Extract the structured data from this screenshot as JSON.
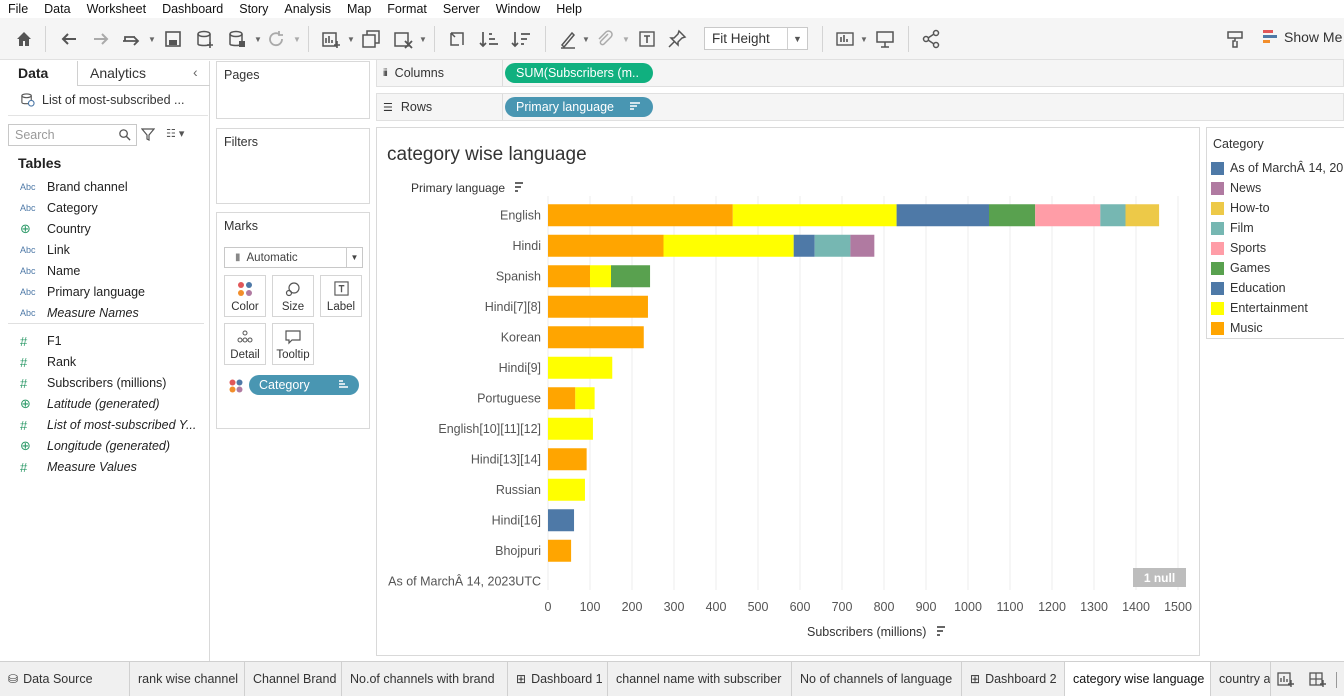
{
  "menu": [
    "File",
    "Data",
    "Worksheet",
    "Dashboard",
    "Story",
    "Analysis",
    "Map",
    "Format",
    "Server",
    "Window",
    "Help"
  ],
  "toolbar": {
    "fit_value": "Fit Height",
    "show_me": "Show Me"
  },
  "left_pane": {
    "tab_data": "Data",
    "tab_analytics": "Analytics",
    "datasource": "List of most-subscribed ...",
    "search_placeholder": "Search",
    "tables_heading": "Tables",
    "fields": [
      {
        "type": "Abc",
        "name": "Brand channel",
        "italic": false
      },
      {
        "type": "Abc",
        "name": "Category",
        "italic": false
      },
      {
        "type": "globe",
        "name": "Country",
        "italic": false
      },
      {
        "type": "Abc",
        "name": "Link",
        "italic": false
      },
      {
        "type": "Abc",
        "name": "Name",
        "italic": false
      },
      {
        "type": "Abc",
        "name": "Primary language",
        "italic": false
      },
      {
        "type": "Abc",
        "name": "Measure Names",
        "italic": true
      },
      {
        "type": "#",
        "name": "F1",
        "italic": false
      },
      {
        "type": "#",
        "name": "Rank",
        "italic": false
      },
      {
        "type": "#",
        "name": "Subscribers (millions)",
        "italic": false
      },
      {
        "type": "globe",
        "name": "Latitude (generated)",
        "italic": true
      },
      {
        "type": "#",
        "name": "List of most-subscribed Y...",
        "italic": true
      },
      {
        "type": "globe",
        "name": "Longitude (generated)",
        "italic": true
      },
      {
        "type": "#",
        "name": "Measure Values",
        "italic": true
      }
    ]
  },
  "cards": {
    "pages": "Pages",
    "filters": "Filters",
    "marks": "Marks",
    "marks_type": "Automatic",
    "buttons": {
      "color": "Color",
      "size": "Size",
      "label": "Label",
      "detail": "Detail",
      "tooltip": "Tooltip"
    },
    "category_pill": "Category"
  },
  "shelves": {
    "columns_label": "Columns",
    "columns_pill": "SUM(Subscribers (m..",
    "rows_label": "Rows",
    "rows_pill": "Primary language"
  },
  "view": {
    "title": "category wise language",
    "row_header": "Primary language",
    "null_badge": "1 null"
  },
  "legend": {
    "title": "Category",
    "items": [
      {
        "label": "As of MarchÂ 14, 20..",
        "color": "#4e79a7"
      },
      {
        "label": "News",
        "color": "#b07aa1"
      },
      {
        "label": "How-to",
        "color": "#edc948"
      },
      {
        "label": "Film",
        "color": "#76b7b2"
      },
      {
        "label": "Sports",
        "color": "#ff9da7"
      },
      {
        "label": "Games",
        "color": "#59a14f"
      },
      {
        "label": "Education",
        "color": "#4e79a7"
      },
      {
        "label": "Entertainment",
        "color": "#ffff00"
      },
      {
        "label": "Music",
        "color": "#ffa500"
      }
    ]
  },
  "chart_data": {
    "type": "bar",
    "orientation": "horizontal",
    "stacked": true,
    "xlabel": "Subscribers (millions)",
    "ylabel": "Primary language",
    "xlim": [
      0,
      1500
    ],
    "xticks": [
      0,
      100,
      200,
      300,
      400,
      500,
      600,
      700,
      800,
      900,
      1000,
      1100,
      1200,
      1300,
      1400,
      1500
    ],
    "colors": {
      "Music": "#ffa500",
      "Entertainment": "#ffff00",
      "Education": "#4e79a7",
      "Games": "#59a14f",
      "Sports": "#ff9da7",
      "Film": "#76b7b2",
      "How-to": "#edc948",
      "News": "#b07aa1"
    },
    "categories": [
      "English",
      "Hindi",
      "Spanish",
      "Hindi[7][8]",
      "Korean",
      "Hindi[9]",
      "Portuguese",
      "English[10][11][12]",
      "Hindi[13][14]",
      "Russian",
      "Hindi[16]",
      "Bhojpuri",
      "As of MarchÂ 14, 2023UTC"
    ],
    "bars": [
      [
        {
          "c": "Music",
          "v": 440
        },
        {
          "c": "Entertainment",
          "v": 390
        },
        {
          "c": "Education",
          "v": 220
        },
        {
          "c": "Games",
          "v": 110
        },
        {
          "c": "Sports",
          "v": 155
        },
        {
          "c": "Film",
          "v": 60
        },
        {
          "c": "How-to",
          "v": 80
        }
      ],
      [
        {
          "c": "Music",
          "v": 275
        },
        {
          "c": "Entertainment",
          "v": 310
        },
        {
          "c": "Education",
          "v": 50
        },
        {
          "c": "Film",
          "v": 85
        },
        {
          "c": "News",
          "v": 57
        }
      ],
      [
        {
          "c": "Music",
          "v": 100
        },
        {
          "c": "Entertainment",
          "v": 50
        },
        {
          "c": "Games",
          "v": 93
        }
      ],
      [
        {
          "c": "Music",
          "v": 238
        }
      ],
      [
        {
          "c": "Music",
          "v": 228
        }
      ],
      [
        {
          "c": "Entertainment",
          "v": 153
        }
      ],
      [
        {
          "c": "Music",
          "v": 65
        },
        {
          "c": "Entertainment",
          "v": 46
        }
      ],
      [
        {
          "c": "Entertainment",
          "v": 107
        }
      ],
      [
        {
          "c": "Music",
          "v": 92
        }
      ],
      [
        {
          "c": "Entertainment",
          "v": 88
        }
      ],
      [
        {
          "c": "Education",
          "v": 62
        }
      ],
      [
        {
          "c": "Music",
          "v": 55
        }
      ],
      []
    ]
  },
  "bottom_tabs": [
    {
      "label": "Data Source",
      "icon": "datasource-icon",
      "active": false
    },
    {
      "label": "rank wise channel",
      "icon": "",
      "active": false
    },
    {
      "label": "Channel Brand",
      "icon": "",
      "active": false
    },
    {
      "label": "No.of channels with brand",
      "icon": "",
      "active": false
    },
    {
      "label": "Dashboard 1",
      "icon": "dashboard-icon",
      "active": false
    },
    {
      "label": "channel name with subscriber",
      "icon": "",
      "active": false
    },
    {
      "label": "No of channels of language",
      "icon": "",
      "active": false
    },
    {
      "label": "Dashboard 2",
      "icon": "dashboard-icon",
      "active": false
    },
    {
      "label": "category wise language",
      "icon": "",
      "active": true
    },
    {
      "label": "country a",
      "icon": "",
      "active": false
    }
  ]
}
